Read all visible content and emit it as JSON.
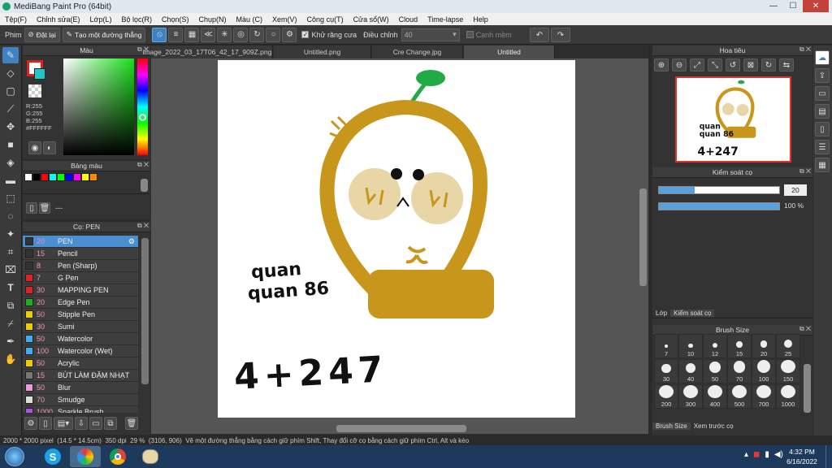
{
  "window": {
    "title": "MediBang Paint Pro (64bit)",
    "min": "—",
    "max": "☐",
    "close": "✕"
  },
  "menu": [
    "Tệp(F)",
    "Chỉnh sửa(E)",
    "Lớp(L)",
    "Bộ lọc(R)",
    "Chọn(S)",
    "Chụp(N)",
    "Màu (C)",
    "Xem(V)",
    "Công cụ(T)",
    "Cửa sổ(W)",
    "Cloud",
    "Time-lapse",
    "Help"
  ],
  "tool_options": {
    "label": "Phim",
    "reset": "Đặt lại",
    "straight": "Tạo một đường thẳng",
    "antialias": "Khử răng cưa",
    "adjust": "Điều chỉnh",
    "adjust_value": "40",
    "edge": "Cạnh mềm"
  },
  "color_panel": {
    "title": "Màu",
    "r": "R:255",
    "g": "G:255",
    "b": "B:255",
    "hex": "#FFFFFF",
    "swatch_colors": [
      "#ffffff",
      "#000000",
      "#ff0000",
      "#00ffff",
      "#00ff00",
      "#0000ff",
      "#ff00ff",
      "#ffff00",
      "#ff8800"
    ]
  },
  "palette_panel": {
    "title": "Bảng màu",
    "value": "---"
  },
  "brush_panel": {
    "title": "Cọ: PEN",
    "items": [
      {
        "size": "20",
        "name": "PEN",
        "color": "#333333"
      },
      {
        "size": "15",
        "name": "Pencil",
        "color": "#333333"
      },
      {
        "size": "8",
        "name": "Pen (Sharp)",
        "color": "#333333"
      },
      {
        "size": "7",
        "name": "G Pen",
        "color": "#dd2222"
      },
      {
        "size": "30",
        "name": "MAPPING PEN",
        "color": "#dd2222"
      },
      {
        "size": "20",
        "name": "Edge Pen",
        "color": "#22aa22"
      },
      {
        "size": "50",
        "name": "Stipple Pen",
        "color": "#eecc00"
      },
      {
        "size": "30",
        "name": "Sumi",
        "color": "#eecc00"
      },
      {
        "size": "50",
        "name": "Watercolor",
        "color": "#44aaee"
      },
      {
        "size": "100",
        "name": "Watercolor (Wet)",
        "color": "#44aaee"
      },
      {
        "size": "50",
        "name": "Acrylic",
        "color": "#eecc00"
      },
      {
        "size": "15",
        "name": "BÚT LÀM ĐẬM NHẠT",
        "color": "#777777"
      },
      {
        "size": "50",
        "name": "Blur",
        "color": "#ee99dd"
      },
      {
        "size": "70",
        "name": "Smudge",
        "color": "#dddddd"
      },
      {
        "size": "1000",
        "name": "Sparkle Brush",
        "color": "#aa55dd"
      }
    ]
  },
  "tabs": [
    "image_2022_03_17T06_42_17_909Z.png",
    "Untitled.png",
    "Cre Change.jpg",
    "Untitled"
  ],
  "canvas_text": {
    "line1": "quan",
    "line2": "quan 86",
    "line3": "4+247"
  },
  "navigator": {
    "title": "Hoa tiêu"
  },
  "brush_control": {
    "title": "Kiểm soát cọ",
    "size_value": "20",
    "size_fraction": 0.3,
    "opacity_value": "100 %",
    "opacity_fraction": 1.0,
    "tabs": [
      "Lớp",
      "Kiểm soát cọ"
    ]
  },
  "brush_size": {
    "title": "Brush Size",
    "sizes": [
      "7",
      "10",
      "12",
      "15",
      "20",
      "25",
      "30",
      "40",
      "50",
      "70",
      "100",
      "150",
      "200",
      "300",
      "400",
      "500",
      "700",
      "1000"
    ],
    "tabs": [
      "Brush Size",
      "Xem trước cọ"
    ]
  },
  "status": {
    "dims": "2000 * 2000 pixel",
    "cm": "(14.5 * 14.5cm)",
    "dpi": "350 dpi",
    "zoom": "29 %",
    "coords": "(3106, 906)",
    "hint": "Vẽ một đường thẳng bằng cách giữ phím Shift, Thay đổi cỡ cọ bằng cách giữ phím Ctrl, Alt và kéo"
  },
  "taskbar": {
    "time": "4:32 PM",
    "date": "6/16/2022"
  },
  "colors": {
    "bulb": "#c8961a",
    "bulb_fill": "#e8d6a6",
    "sprout": "#22aa44",
    "accent": "#3e82c4"
  }
}
